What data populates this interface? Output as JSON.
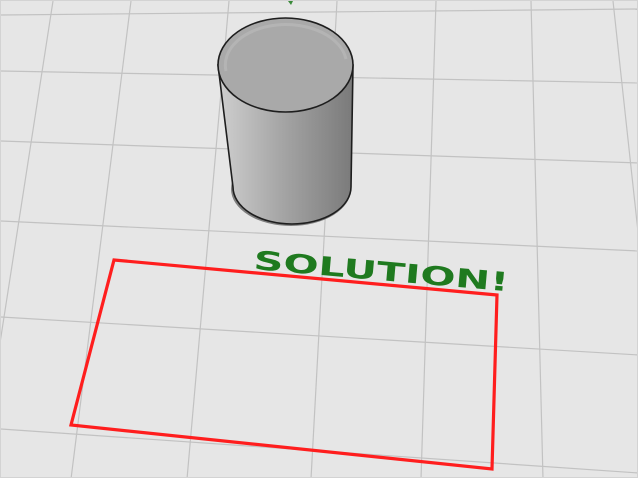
{
  "viewport": {
    "projection": "perspective",
    "grid_visible": true,
    "background_color": "#e6e6e6",
    "grid_color": "#c2c2c2"
  },
  "scene": {
    "objects": [
      {
        "name": "cylinder",
        "shading": "shaded",
        "colors": {
          "side_light": "#c4c4c4",
          "side_mid": "#9f9f9f",
          "side_dark": "#7e7e7e",
          "top": "#a9a9a9",
          "outline": "#1e1e1e"
        }
      },
      {
        "name": "rectangle",
        "selected": true,
        "color": "#ff1e1e"
      },
      {
        "name": "text-object",
        "text": "SOLUTION!",
        "color": "#1f7a1f"
      }
    ]
  }
}
